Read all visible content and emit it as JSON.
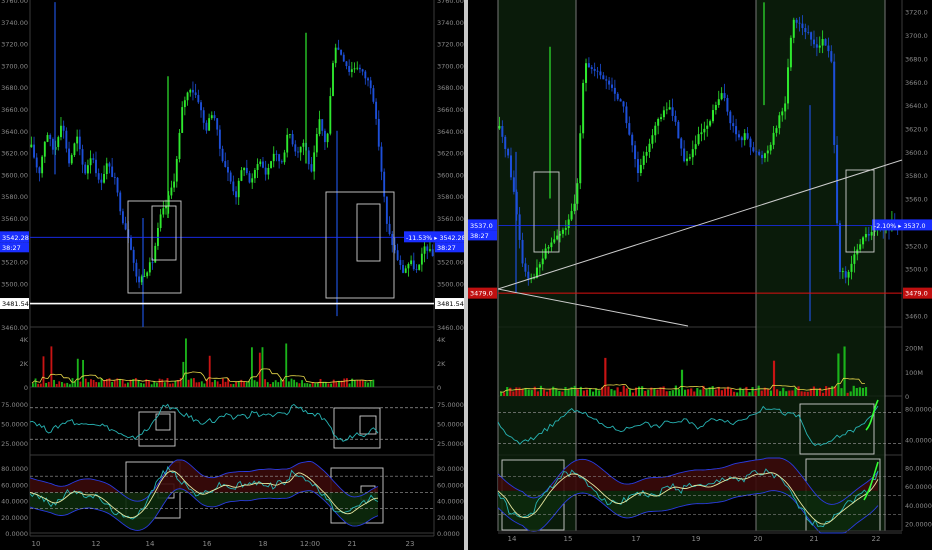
{
  "colors": {
    "bg": "#000000",
    "up": "#2ee82e",
    "down": "#1d4fd8",
    "vol_up": "#1bb31b",
    "vol_down": "#c81414",
    "osc": "#27b3b3",
    "sma_slow": "#e8e8a0",
    "box": "#cfcfcf",
    "band_fill_top": "#3a0a0a",
    "band_fill_bottom": "#0c2a0c",
    "blue_line": "#1a2fff",
    "red_line": "#dd1111",
    "tick_text": "#8a8a8a"
  },
  "chart_data": [
    {
      "type": "line",
      "panel": "left",
      "price": {
        "y_ticks": [
          "3760.00",
          "3740.00",
          "3720.00",
          "3700.00",
          "3680.00",
          "3660.00",
          "3640.00",
          "3620.00",
          "3600.00",
          "3580.00",
          "3560.00",
          "3540.00",
          "3520.00",
          "3500.00",
          "3480.00",
          "3460.00"
        ],
        "ylim": [
          3460,
          3760
        ],
        "series": [
          3625,
          3600,
          3640,
          3620,
          3650,
          3610,
          3635,
          3600,
          3620,
          3590,
          3610,
          3595,
          3560,
          3540,
          3500,
          3510,
          3520,
          3560,
          3575,
          3600,
          3665,
          3680,
          3670,
          3640,
          3660,
          3620,
          3600,
          3580,
          3610,
          3590,
          3615,
          3600,
          3620,
          3610,
          3640,
          3620,
          3630,
          3600,
          3650,
          3625,
          3720,
          3710,
          3695,
          3700,
          3690,
          3680,
          3620,
          3550,
          3530,
          3510,
          3520,
          3510,
          3535,
          3525
        ],
        "current_left_label": "3542.28",
        "current_left_time": "38:27",
        "current_right_label": "3542.28",
        "current_right_pct": "-11.53%",
        "current_right_time": "38:27",
        "current_value": 3542.28,
        "white_line_label_left": "3481.54",
        "white_line_label_right": "3481.54",
        "white_line_value": 3481.54
      },
      "volume": {
        "y_ticks_left": [
          "4K",
          "2K",
          "0"
        ],
        "y_ticks_right": [
          "4K",
          "2K",
          "0"
        ],
        "ylim": [
          0,
          4500
        ]
      },
      "rsi": {
        "y_ticks": [
          "75.0000",
          "50.0000",
          "25.0000"
        ],
        "ylim": [
          10,
          90
        ],
        "levels": [
          70,
          30
        ],
        "series": [
          55,
          50,
          45,
          40,
          45,
          50,
          55,
          50,
          48,
          52,
          50,
          48,
          44,
          40,
          35,
          30,
          32,
          38,
          42,
          55,
          70,
          72,
          68,
          62,
          60,
          55,
          50,
          55,
          52,
          58,
          60,
          56,
          62,
          58,
          65,
          60,
          62,
          58,
          64,
          60,
          74,
          70,
          66,
          62,
          60,
          52,
          40,
          30,
          28,
          34,
          38,
          36,
          44,
          40
        ]
      },
      "stoch": {
        "y_ticks": [
          "80.0000",
          "60.0000",
          "40.0000",
          "20.0000",
          "0.0000"
        ],
        "ylim": [
          0,
          90
        ],
        "series": [
          50,
          45,
          42,
          36,
          38,
          44,
          52,
          50,
          46,
          48,
          45,
          40,
          32,
          26,
          20,
          18,
          22,
          30,
          42,
          58,
          72,
          78,
          74,
          64,
          56,
          50,
          46,
          52,
          54,
          60,
          58,
          55,
          60,
          58,
          63,
          60,
          62,
          57,
          64,
          60,
          76,
          73,
          68,
          60,
          52,
          44,
          32,
          26,
          22,
          28,
          34,
          38,
          44,
          42
        ]
      },
      "x_ticks": [
        "10",
        "12",
        "14",
        "16",
        "18",
        "12:00",
        "21",
        "23"
      ]
    },
    {
      "type": "line",
      "panel": "right",
      "price": {
        "y_ticks": [
          "3720.0",
          "3700.0",
          "3680.0",
          "3660.0",
          "3640.0",
          "3620.0",
          "3600.0",
          "3580.0",
          "3560.0",
          "3540.0",
          "3520.0",
          "3500.0",
          "3480.0",
          "3460.0"
        ],
        "ylim": [
          3450,
          3730
        ],
        "series": [
          3620,
          3600,
          3560,
          3505,
          3490,
          3500,
          3515,
          3525,
          3530,
          3540,
          3560,
          3680,
          3670,
          3665,
          3660,
          3650,
          3640,
          3610,
          3580,
          3600,
          3620,
          3630,
          3640,
          3620,
          3590,
          3600,
          3615,
          3620,
          3640,
          3650,
          3625,
          3610,
          3615,
          3600,
          3595,
          3605,
          3625,
          3640,
          3715,
          3710,
          3700,
          3690,
          3695,
          3680,
          3500,
          3490,
          3510,
          3525,
          3530,
          3535,
          3530,
          3540,
          3535
        ],
        "current_left_label": "3537.0",
        "current_left_time": "38:27",
        "current_right_label": "3537.0",
        "current_right_pct": "-2.10%",
        "current_value": 3537.0,
        "red_line_label_left": "3479.0",
        "red_line_label_right": "3479.0",
        "red_line_value": 3479.0
      },
      "volume": {
        "y_ticks": [
          "200M",
          "100M",
          "0"
        ],
        "ylim": [
          0,
          260
        ]
      },
      "rsi": {
        "y_ticks": [
          "80.0000",
          "40.0000"
        ],
        "ylim": [
          20,
          90
        ],
        "levels": [
          75,
          35
        ],
        "series": [
          60,
          50,
          40,
          35,
          38,
          42,
          50,
          55,
          62,
          70,
          76,
          80,
          74,
          68,
          62,
          58,
          55,
          52,
          54,
          58,
          62,
          60,
          56,
          60,
          64,
          62,
          66,
          60,
          56,
          62,
          66,
          68,
          64,
          62,
          66,
          70,
          76,
          80,
          82,
          78,
          74,
          72,
          70,
          48,
          34,
          30,
          36,
          42,
          46,
          50,
          54,
          60,
          70,
          85
        ]
      },
      "stoch": {
        "y_ticks": [
          "80.0000",
          "60.0000",
          "40.0000",
          "20.0000"
        ],
        "ylim": [
          10,
          90
        ],
        "series": [
          55,
          40,
          30,
          25,
          28,
          35,
          48,
          58,
          66,
          72,
          74,
          70,
          64,
          58,
          50,
          44,
          40,
          44,
          50,
          54,
          52,
          48,
          52,
          58,
          60,
          56,
          60,
          62,
          58,
          60,
          64,
          68,
          70,
          66,
          70,
          74,
          72,
          76,
          70,
          64,
          52,
          40,
          30,
          22,
          18,
          22,
          30,
          36,
          42,
          48,
          52,
          60,
          76
        ]
      },
      "x_ticks": [
        "14",
        "15",
        "17",
        "19",
        "20",
        "21",
        "22"
      ]
    }
  ]
}
